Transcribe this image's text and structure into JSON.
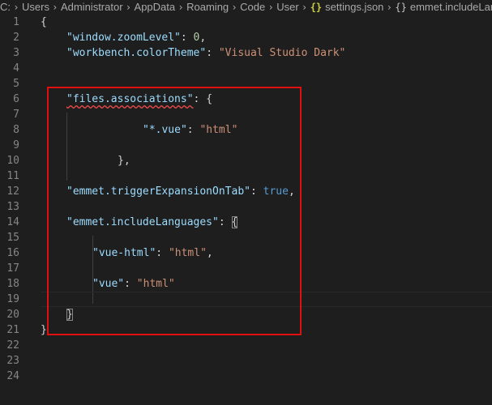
{
  "breadcrumb": {
    "items": [
      "C:",
      "Users",
      "Administrator",
      "AppData",
      "Roaming",
      "Code",
      "User"
    ],
    "file": "settings.json",
    "symbol": "emmet.includeLanguages",
    "file_icon_glyph": "{}",
    "symbol_icon_glyph": "{}",
    "file_icon": "json-file-icon",
    "symbol_icon": "object-symbol-icon"
  },
  "editor": {
    "line_numbers": [
      "1",
      "2",
      "3",
      "4",
      "5",
      "6",
      "7",
      "8",
      "9",
      "10",
      "11",
      "12",
      "13",
      "14",
      "15",
      "16",
      "17",
      "18",
      "19",
      "20",
      "21",
      "22",
      "23",
      "24"
    ],
    "lines": {
      "l1": {
        "open": "{"
      },
      "l2": {
        "key": "\"window.zoomLevel\"",
        "colon": ": ",
        "value": "0",
        "comma": ","
      },
      "l3": {
        "key": "\"workbench.colorTheme\"",
        "colon": ": ",
        "value": "\"Visual Studio Dark\""
      },
      "l6": {
        "key": "\"files.associations\"",
        "colon": ": ",
        "brace": "{"
      },
      "l8": {
        "key": "\"*.vue\"",
        "colon": ": ",
        "value": "\"html\""
      },
      "l10": {
        "close": "},"
      },
      "l12": {
        "key": "\"emmet.triggerExpansionOnTab\"",
        "colon": ": ",
        "value": "true",
        "comma": ","
      },
      "l14": {
        "key": "\"emmet.includeLanguages\"",
        "colon": ": ",
        "brace": "{"
      },
      "l16": {
        "key": "\"vue-html\"",
        "colon": ": ",
        "value": "\"html\"",
        "comma": ","
      },
      "l18": {
        "key": "\"vue\"",
        "colon": ": ",
        "value": "\"html\""
      },
      "l20": {
        "close": "}"
      },
      "l21": {
        "close": "}"
      }
    }
  },
  "colors": {
    "background": "#1e1e1e",
    "key": "#9cdcfe",
    "string": "#ce9178",
    "number": "#b5cea8",
    "boolean": "#569cd6",
    "line_number": "#858585",
    "annotation_box": "#e01010"
  }
}
